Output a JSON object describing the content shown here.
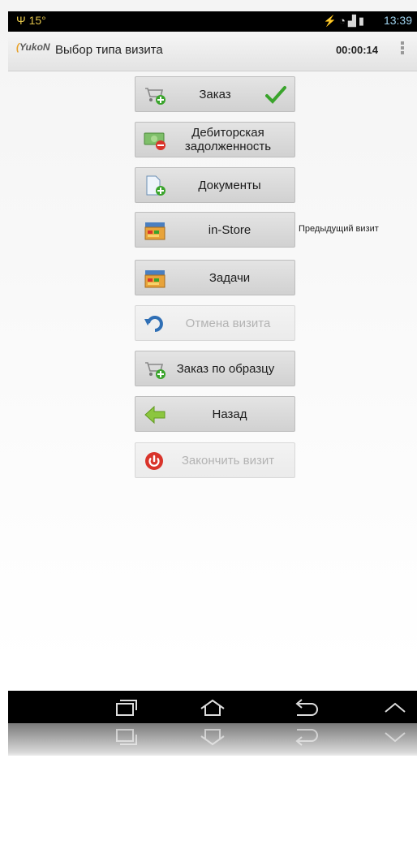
{
  "status_bar": {
    "left": "Ψ 15°",
    "time": "13:39",
    "icons": [
      "usb-icon",
      "wifi-icon",
      "signal-icon",
      "battery-icon"
    ]
  },
  "action_bar": {
    "logo": "YukoN",
    "title": "Выбор типа визита",
    "timer": "00:00:14"
  },
  "buttons": {
    "order": {
      "label": "Заказ",
      "enabled": true
    },
    "debt": {
      "label": "Дебиторская\nзадолженность",
      "enabled": true
    },
    "documents": {
      "label": "Документы",
      "enabled": true
    },
    "in_store": {
      "label": "in-Store",
      "enabled": true
    },
    "tasks": {
      "label": "Задачи",
      "enabled": true
    },
    "cancel_visit": {
      "label": "Отмена визита",
      "enabled": false
    },
    "order_by_sample": {
      "label": "Заказ по образцу",
      "enabled": true
    },
    "back": {
      "label": "Назад",
      "enabled": true
    },
    "finish_visit": {
      "label": "Закончить визит",
      "enabled": false
    }
  },
  "previous_visit": "Предыдущий визит",
  "colors": {
    "check": "#3aa42c",
    "back_arrow": "#8cc63f",
    "stop": "#d9342b",
    "undo": "#2f6fb5"
  }
}
